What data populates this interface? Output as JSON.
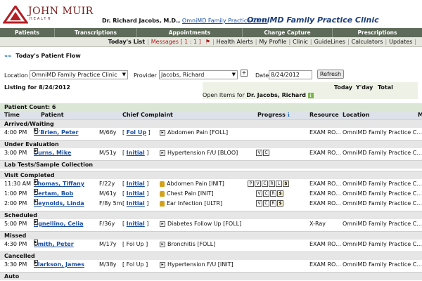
{
  "header": {
    "logo_name": "JOHN MUIR",
    "logo_sub": "HEALTH",
    "doctor_label": "Dr. Richard Jacobs, M.D.,",
    "doctor_link": "OmniMD Family Practice Clinic",
    "clinic_title": "OmniMD Family Practice Clinic"
  },
  "nav": [
    "Patients",
    "Transcriptions",
    "Appointments",
    "Charge Capture",
    "Prescriptions"
  ],
  "subnav": [
    "Today's List",
    "Messages [ 1 : 1 ]",
    "Health Alerts",
    "My Profile",
    "Clinic",
    "GuideLines",
    "Calculators",
    "Updates"
  ],
  "flow_title": "Today's Patient Flow",
  "filters": {
    "location_label": "Location",
    "location_value": "OmniMD Family Practice Clinic",
    "provider_label": "Provider",
    "provider_value": "Jacobs, Richard",
    "date_label": "Date",
    "date_value": "8/24/2012",
    "refresh_label": "Refresh"
  },
  "listing": "Listing for 8/24/2012",
  "stats_headers": [
    "Today",
    "Y'day",
    "Total"
  ],
  "open_items": "Open Items for",
  "open_items_doctor": "Dr. Jacobs, Richard",
  "patient_count": "Patient Count: 6",
  "columns": [
    "Time",
    "Patient",
    "Chief Complaint",
    "Progress",
    "Resource",
    "Location"
  ],
  "sections": [
    {
      "title": "Arrived/Waiting",
      "rows": [
        {
          "time": "4:00 PM",
          "name": "O'Brien, Peter",
          "age": "M/66y",
          "type": "Fol Up",
          "type_link": true,
          "icon": "note",
          "complaint": "Abdomen Pain [FOLL]",
          "progress": [],
          "resource": "EXAM RO...",
          "location": "OmniMD Family Practice C..."
        }
      ]
    },
    {
      "title": "Under Evaluation",
      "rows": [
        {
          "time": "3:00 PM",
          "name": "Burns, Mike",
          "age": "M/51y",
          "type": "Initial",
          "type_link": true,
          "icon": "note",
          "complaint": "Hypertension F/U [BLOO]",
          "progress": [
            "V",
            "C"
          ],
          "resource": "EXAM RO...",
          "location": "OmniMD Family Practice C..."
        }
      ]
    },
    {
      "title": "Lab Tests/Sample Collection",
      "rows": []
    },
    {
      "title": "Visit Completed",
      "rows": [
        {
          "time": "11:30 AM",
          "name": "Thomas, Tiffany",
          "age": "F/22y",
          "type": "Initial",
          "type_link": true,
          "icon": "lock",
          "complaint": "Abdomen Pain [INIT]",
          "progress": [
            "P",
            "V",
            "C",
            "R",
            "L",
            "$"
          ],
          "resource": "EXAM RO...",
          "location": "OmniMD Family Practice C..."
        },
        {
          "time": "1:00 PM",
          "name": "Bertam, Bob",
          "age": "M/61y",
          "type": "Initial",
          "type_link": true,
          "icon": "lock",
          "complaint": "Chest Pain [INIT]",
          "progress": [
            "V",
            "C",
            "R",
            "$"
          ],
          "resource": "EXAM RO...",
          "location": "OmniMD Family Practice C..."
        },
        {
          "time": "2:00 PM",
          "name": "Reynolds, Linda",
          "age": "F/8y 5m",
          "type": "Initial",
          "type_link": true,
          "icon": "lock",
          "complaint": "Ear Infection [ULTR]",
          "progress": [
            "V",
            "C",
            "R",
            "$"
          ],
          "resource": "EXAM RO...",
          "location": "OmniMD Family Practice C..."
        }
      ]
    },
    {
      "title": "Scheduled",
      "rows": [
        {
          "time": "5:00 PM",
          "name": "Agnellino, Celia",
          "age": "F/36y",
          "type": "Initial",
          "type_link": true,
          "icon": "note",
          "complaint": "Diabetes Follow Up [FOLL]",
          "progress": [],
          "resource": "X-Ray",
          "location": "OmniMD Family Practice C..."
        }
      ]
    },
    {
      "title": "Missed",
      "rows": [
        {
          "time": "4:30 PM",
          "name": "Smith, Peter",
          "age": "M/17y",
          "type": "Fol Up",
          "type_link": false,
          "icon": "note",
          "complaint": "Bronchitis [FOLL]",
          "progress": [],
          "resource": "EXAM RO...",
          "location": "OmniMD Family Practice C..."
        }
      ]
    },
    {
      "title": "Cancelled",
      "rows": [
        {
          "time": "3:30 PM",
          "name": "Clarkson, James",
          "age": "M/38y",
          "type": "Fol Up",
          "type_link": false,
          "icon": "note",
          "complaint": "Hypertension F/U [INIT]",
          "progress": [],
          "resource": "EXAM RO...",
          "location": "OmniMD Family Practice C..."
        }
      ]
    },
    {
      "title": "Auto",
      "rows": []
    }
  ]
}
